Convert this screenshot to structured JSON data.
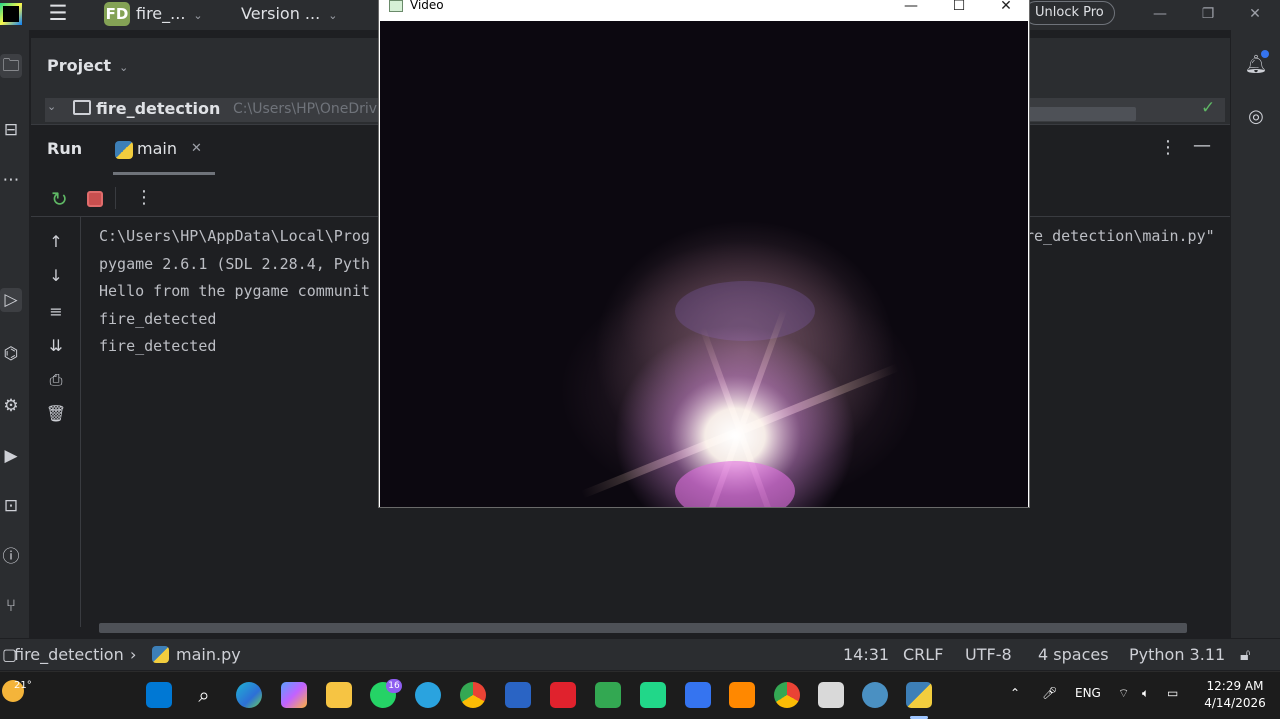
{
  "titlebar": {
    "project_badge": "FD",
    "project_name": "fire_...",
    "vcs": "Version ...",
    "unlock": "Unlock Pro"
  },
  "project": {
    "header": "Project",
    "root_name": "fire_detection",
    "root_path": "C:\\Users\\HP\\OneDriv"
  },
  "run": {
    "title": "Run",
    "tab_label": "main",
    "console_lines": [
      "C:\\Users\\HP\\AppData\\Local\\Prog",
      "pygame 2.6.1 (SDL 2.28.4, Pyth",
      "Hello from the pygame communit",
      "fire_detected",
      "fire_detected"
    ],
    "console_line1_tail": "re_detection\\main.py\""
  },
  "video": {
    "title": "Video"
  },
  "statusbar": {
    "crumb_project": "fire_detection",
    "crumb_file": "main.py",
    "position": "14:31",
    "line_sep": "CRLF",
    "encoding": "UTF-8",
    "indent": "4 spaces",
    "interpreter": "Python 3.11"
  },
  "taskbar": {
    "temperature": "21°",
    "whatsapp_badge": "16",
    "lang": "ENG",
    "time": "12:29 AM",
    "date": "4/14/2026"
  }
}
